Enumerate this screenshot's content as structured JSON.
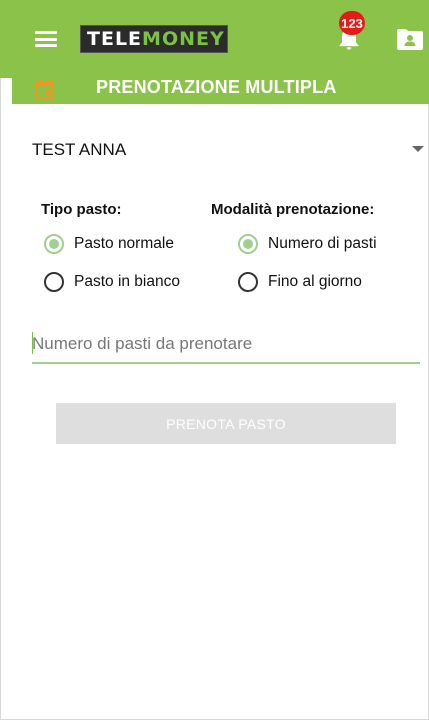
{
  "appbar": {
    "logo": {
      "part1": "TELE",
      "part2": "MONEY"
    },
    "notifications": {
      "count": "123"
    }
  },
  "subheader": {
    "title": "PRENOTAZIONE MULTIPLA"
  },
  "selector": {
    "value": "TEST ANNA"
  },
  "meal_type": {
    "label": "Tipo pasto:",
    "options": [
      {
        "label": "Pasto normale",
        "selected": true
      },
      {
        "label": "Pasto in bianco",
        "selected": false
      }
    ]
  },
  "booking_mode": {
    "label": "Modalità prenotazione:",
    "options": [
      {
        "label": "Numero di pasti",
        "selected": true
      },
      {
        "label": "Fino al giorno",
        "selected": false
      }
    ]
  },
  "meals_input": {
    "value": "",
    "placeholder": "Numero di pasti da prenotare"
  },
  "book_button": {
    "label": "PRENOTA PASTO",
    "enabled": false
  },
  "colors": {
    "accent": "#8bc34a",
    "radio_selected": "#9fd08e",
    "badge": "#e31b1b",
    "calendar_icon": "#f5941f",
    "button_disabled": "#dedede"
  }
}
